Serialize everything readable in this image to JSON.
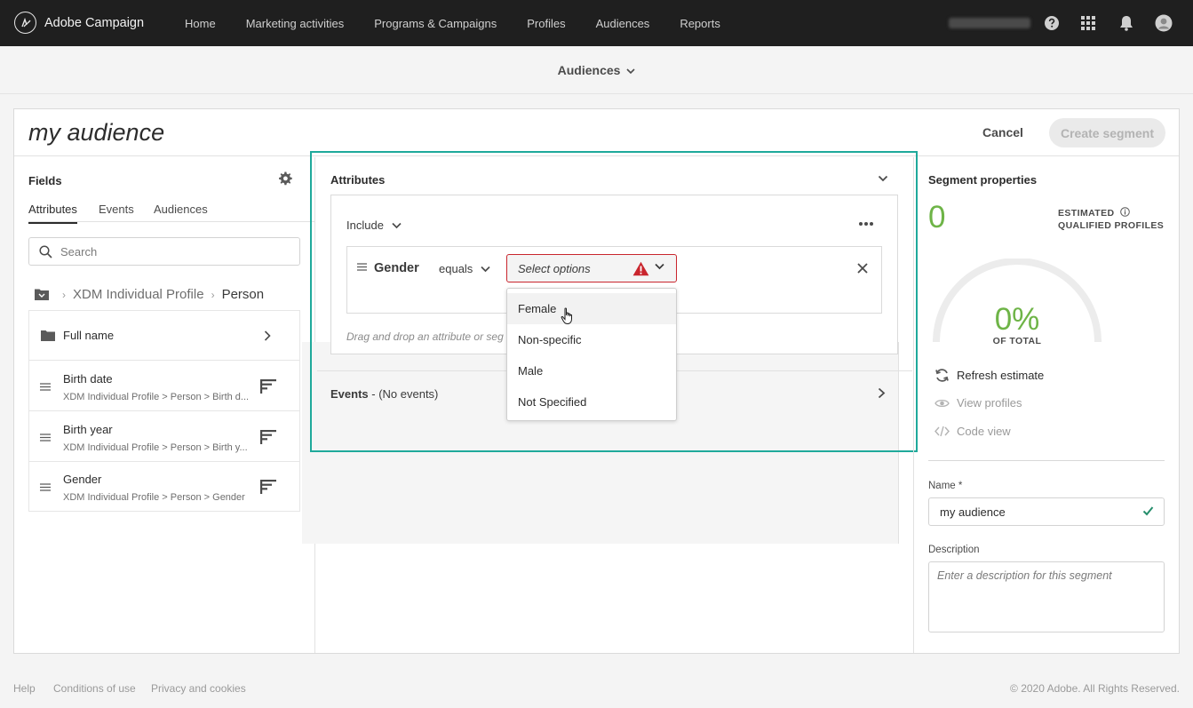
{
  "app": {
    "brand": "Adobe Campaign"
  },
  "nav": {
    "items": [
      "Home",
      "Marketing activities",
      "Programs & Campaigns",
      "Profiles",
      "Audiences",
      "Reports"
    ]
  },
  "subheader": {
    "title": "Audiences"
  },
  "segment": {
    "title": "my audience",
    "cancel_label": "Cancel",
    "create_label": "Create segment"
  },
  "fields": {
    "title": "Fields",
    "tabs": [
      "Attributes",
      "Events",
      "Audiences"
    ],
    "search_placeholder": "Search",
    "breadcrumb": {
      "root": "XDM Individual Profile",
      "current": "Person"
    },
    "folder": {
      "label": "Full name"
    },
    "items": [
      {
        "name": "Birth date",
        "path": "XDM Individual Profile > Person > Birth d..."
      },
      {
        "name": "Birth year",
        "path": "XDM Individual Profile > Person > Birth y..."
      },
      {
        "name": "Gender",
        "path": "XDM Individual Profile > Person > Gender"
      }
    ]
  },
  "attributes": {
    "title": "Attributes",
    "include_label": "Include",
    "condition": {
      "field": "Gender",
      "operator": "equals",
      "value_placeholder": "Select options"
    },
    "drop_hint": "Drag and drop an attribute or seg",
    "options": [
      "Female",
      "Non-specific",
      "Male",
      "Not Specified"
    ]
  },
  "events": {
    "label": "Events",
    "suffix": " - (No events)"
  },
  "properties": {
    "title": "Segment properties",
    "count": "0",
    "estimated_line1": "ESTIMATED",
    "estimated_line2": "QUALIFIED PROFILES",
    "percent": "0%",
    "percent_label": "OF TOTAL",
    "refresh_label": "Refresh estimate",
    "view_profiles_label": "View profiles",
    "code_view_label": "Code view",
    "name_label": "Name *",
    "name_value": "my audience",
    "description_label": "Description",
    "description_placeholder": "Enter a description for this segment"
  },
  "footer": {
    "links": [
      "Help",
      "Conditions of use",
      "Privacy and cookies"
    ],
    "copyright": "© 2020 Adobe. All Rights Reserved."
  },
  "colors": {
    "accent": "#1fa99b",
    "success": "#6eb447",
    "error": "#c9252d",
    "topbar": "#1f1f1f"
  }
}
